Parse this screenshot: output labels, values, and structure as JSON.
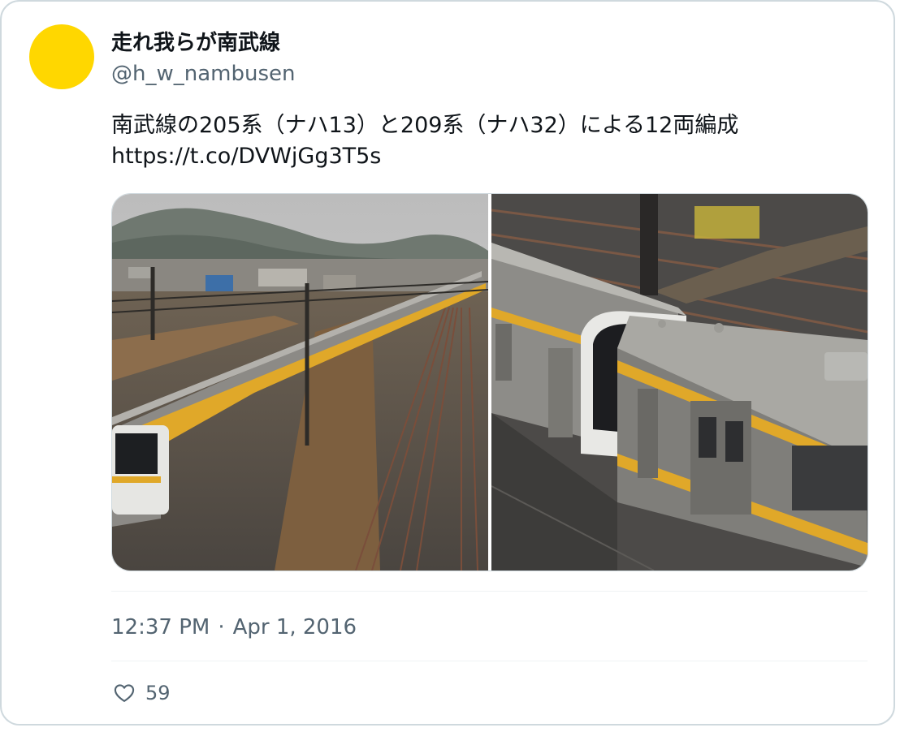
{
  "user": {
    "display_name": "走れ我らが南武線",
    "handle": "@h_w_nambusen",
    "avatar_color": "#ffd700"
  },
  "tweet": {
    "text": "南武線の205系（ナハ13）と209系（ナハ32）による12両編成",
    "link": "https://t.co/DVWjGg3T5s"
  },
  "media": {
    "photos": [
      {
        "label": "train-photo-left"
      },
      {
        "label": "train-photo-right"
      }
    ]
  },
  "meta": {
    "time": "12:37 PM",
    "separator": "·",
    "date": "Apr 1, 2016"
  },
  "actions": {
    "like_icon": "heart-icon",
    "like_count": "59"
  },
  "colors": {
    "text_primary": "#0f1419",
    "text_secondary": "#536471",
    "border": "#cfd9de"
  }
}
